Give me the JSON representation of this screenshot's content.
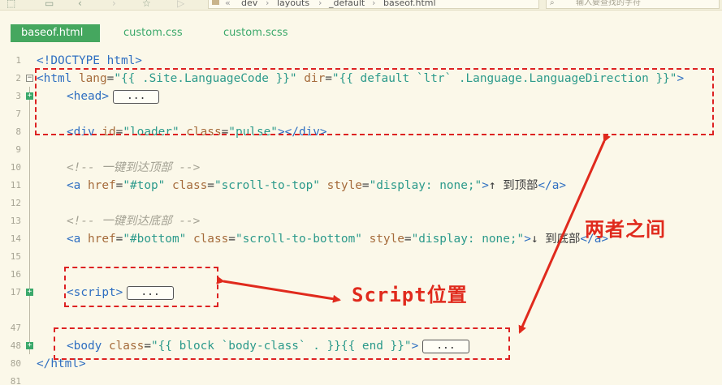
{
  "toolbar": {
    "breadcrumb": [
      "dev",
      "layouts",
      "_default",
      "baseof.html"
    ],
    "breadcrumb_lead": "«",
    "search_placeholder": "输入要查找的字符"
  },
  "tabs": [
    {
      "label": "baseof.html",
      "active": true
    },
    {
      "label": "custom.css",
      "active": false
    },
    {
      "label": "custom.scss",
      "active": false
    }
  ],
  "colors": {
    "tab_active": "#45a75f",
    "annotation": "#dd2222",
    "background": "#fbf8e9"
  },
  "editor": {
    "lines": [
      {
        "num": "1"
      },
      {
        "num": "2"
      },
      {
        "num": "3"
      },
      {
        "num": "7"
      },
      {
        "num": "8"
      },
      {
        "num": "9"
      },
      {
        "num": "10"
      },
      {
        "num": "11"
      },
      {
        "num": "12"
      },
      {
        "num": "13"
      },
      {
        "num": "14"
      },
      {
        "num": "15"
      },
      {
        "num": "16"
      },
      {
        "num": "17"
      },
      {
        "num": "47"
      },
      {
        "num": "48"
      },
      {
        "num": "80"
      },
      {
        "num": "81"
      }
    ],
    "code": {
      "l1": "<!DOCTYPE html>",
      "l2_open": "<html ",
      "l2_lang_attr": "lang",
      "l2_eq1": "=",
      "l2_lang_val": "\"{{ .Site.LanguageCode }}\"",
      "l2_dir_attr": " dir",
      "l2_eq2": "=",
      "l2_dir_val": "\"{{ default `ltr` .Language.LanguageDirection }}\"",
      "l2_close": ">",
      "l3": "<head>",
      "l8_open": "<div ",
      "l8_id_attr": "id",
      "l8_eq1": "=",
      "l8_id_val": "\"loader\"",
      "l8_class_attr": " class",
      "l8_eq2": "=",
      "l8_class_val": "\"pulse\"",
      "l8_close": "></div>",
      "l10": "<!-- 一键到达顶部 -->",
      "l11_open": "<a ",
      "l11_href_attr": "href",
      "l11_eq1": "=",
      "l11_href_val": "\"#top\"",
      "l11_class_attr": " class",
      "l11_eq2": "=",
      "l11_class_val": "\"scroll-to-top\"",
      "l11_style_attr": " style",
      "l11_eq3": "=",
      "l11_style_val": "\"display: none;\"",
      "l11_gt": ">",
      "l11_text": "↑ 到顶部",
      "l11_close": "</a>",
      "l13": "<!-- 一键到达底部 -->",
      "l14_open": "<a ",
      "l14_href_attr": "href",
      "l14_eq1": "=",
      "l14_href_val": "\"#bottom\"",
      "l14_class_attr": " class",
      "l14_eq2": "=",
      "l14_class_val": "\"scroll-to-bottom\"",
      "l14_style_attr": " style",
      "l14_eq3": "=",
      "l14_style_val": "\"display: none;\"",
      "l14_gt": ">",
      "l14_text": "↓ 到底部",
      "l14_close": "</a>",
      "l17": "<script>",
      "l48_open": "<body ",
      "l48_class_attr": "class",
      "l48_eq": "=",
      "l48_class_val": "\"{{ block `body-class` . }}{{ end }}\"",
      "l48_close": ">",
      "l80": "</html>",
      "collapsed": "..."
    }
  },
  "annotations": {
    "between_label": "两者之间",
    "script_label": "Script位置"
  }
}
